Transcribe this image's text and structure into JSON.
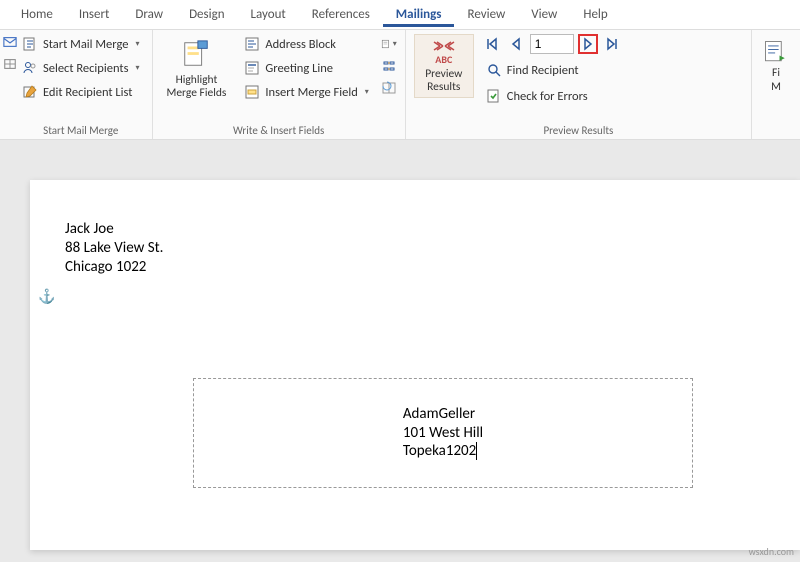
{
  "tabs": {
    "home": "Home",
    "insert": "Insert",
    "draw": "Draw",
    "design": "Design",
    "layout": "Layout",
    "references": "References",
    "mailings": "Mailings",
    "review": "Review",
    "view": "View",
    "help": "Help"
  },
  "ribbon": {
    "start": {
      "start_mail_merge": "Start Mail Merge",
      "select_recipients": "Select Recipients",
      "edit_recipient_list": "Edit Recipient List",
      "group_label": "Start Mail Merge"
    },
    "write": {
      "highlight_merge_fields": "Highlight\nMerge Fields",
      "address_block": "Address Block",
      "greeting_line": "Greeting Line",
      "insert_merge_field": "Insert Merge Field",
      "group_label": "Write & Insert Fields"
    },
    "preview": {
      "abc": "ABC",
      "preview_results": "Preview\nResults",
      "record_value": "1",
      "find_recipient": "Find Recipient",
      "check_errors": "Check for Errors",
      "group_label": "Preview Results"
    },
    "finish": {
      "label": "Fi",
      "sub": "M"
    }
  },
  "document": {
    "return_address": {
      "line1": "Jack Joe",
      "line2": "88 Lake View St.",
      "line3": "Chicago 1022"
    },
    "recipient": {
      "line1": "AdamGeller",
      "line2": "101 West Hill",
      "line3": "Topeka1202"
    }
  },
  "watermark": "wsxdn.com"
}
